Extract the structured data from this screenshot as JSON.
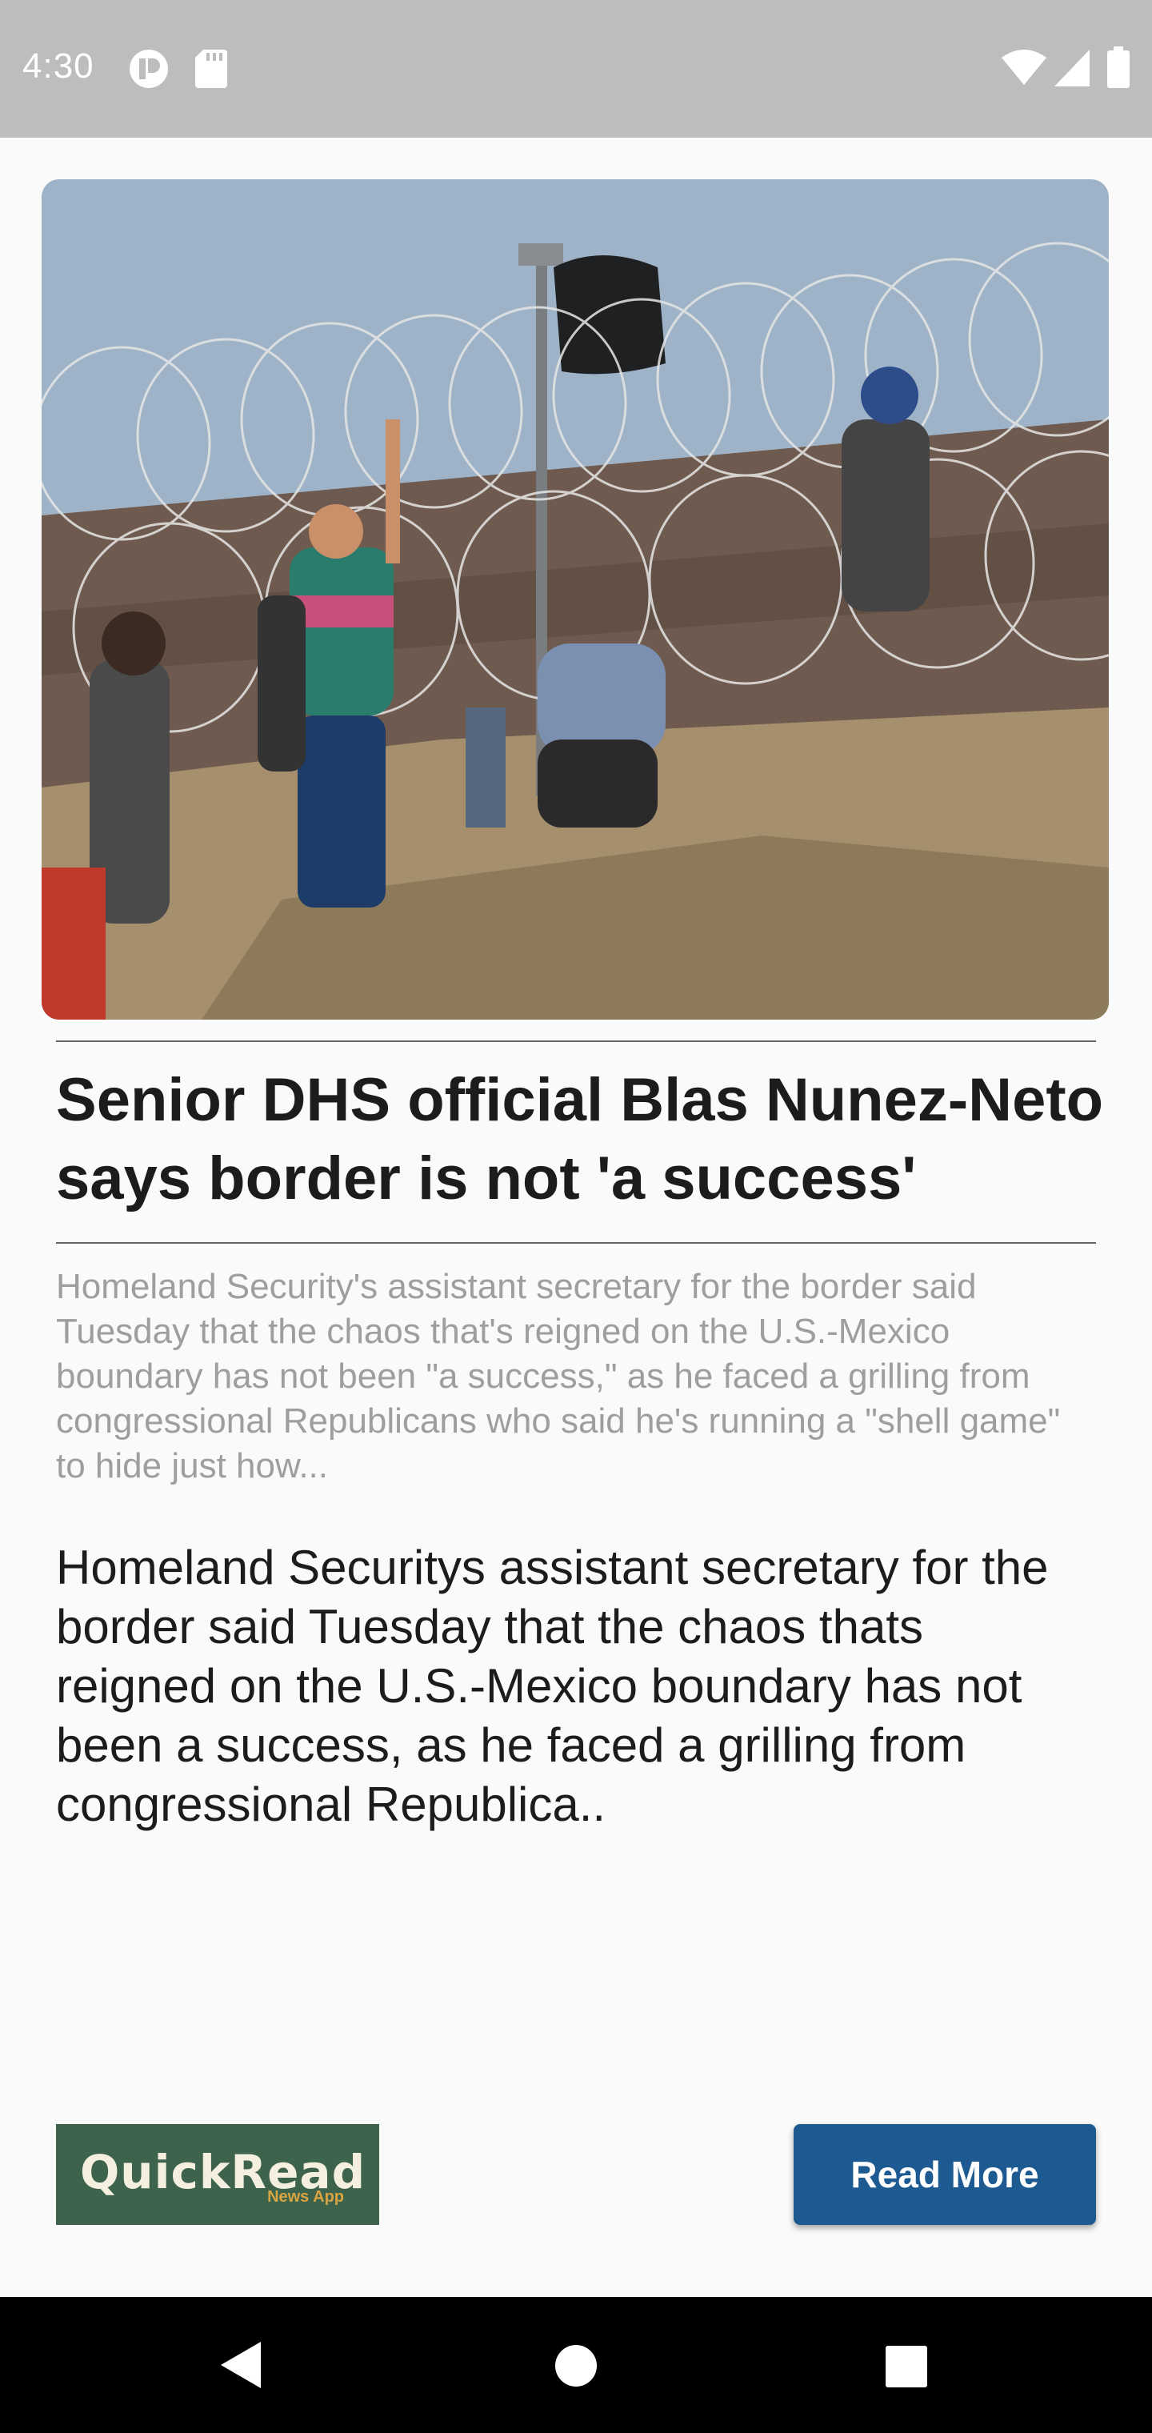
{
  "status_bar": {
    "time": "4:30",
    "icons": [
      "app-notification-icon",
      "sd-card-icon",
      "wifi-icon",
      "cell-signal-icon",
      "battery-icon"
    ]
  },
  "article": {
    "image_description_alt": "",
    "headline": "Senior DHS official Blas Nunez-Neto says border is not 'a success'",
    "summary": "Homeland Security's assistant secretary for the border said Tuesday that the chaos that's reigned on the U.S.-Mexico boundary has not been \"a success,\" as he faced a grilling from congressional Republicans who said he's running a \"shell game\" to hide just how...",
    "body": "Homeland Securitys assistant secretary for the border said Tuesday that the chaos thats reigned on the U.S.-Mexico boundary has not been a success, as he faced a grilling from congressional Republica.."
  },
  "footer": {
    "logo_main": "QuickRead",
    "logo_sub": "News App",
    "read_more_label": "Read More"
  },
  "colors": {
    "status_bar_bg": "#bdbdbd",
    "page_bg": "#fafafa",
    "button_bg": "#1d5a91",
    "logo_bg": "#3d634c",
    "logo_accent": "#d9a441",
    "nav_bar_bg": "#000000"
  },
  "nav_bar": {
    "icons": [
      "back-icon",
      "home-icon",
      "recents-icon"
    ]
  }
}
